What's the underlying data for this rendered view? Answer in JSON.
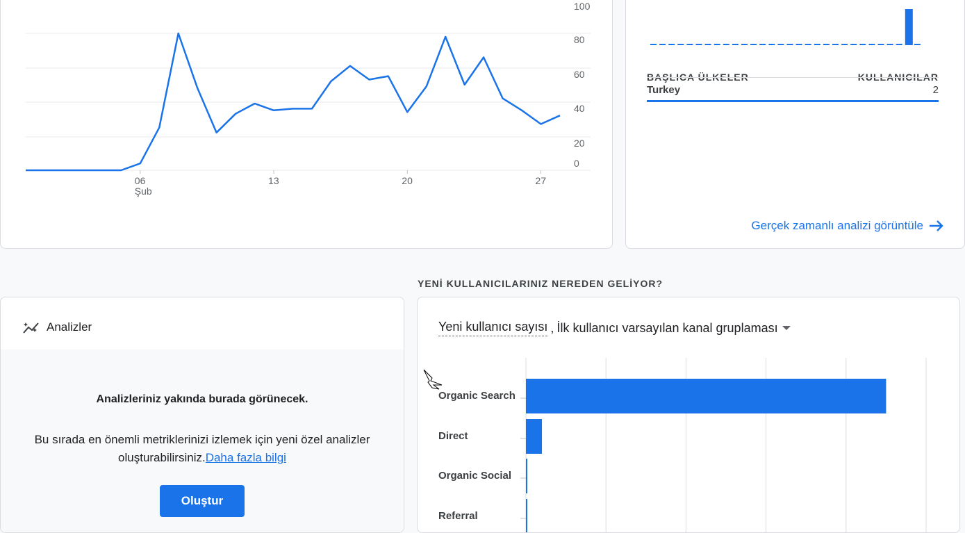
{
  "line_chart": {
    "type": "line",
    "y_ticks": [
      "100",
      "80",
      "60",
      "40",
      "20",
      "0"
    ],
    "x_ticks": [
      {
        "day": "06",
        "month": "Şub"
      },
      {
        "day": "13",
        "month": ""
      },
      {
        "day": "20",
        "month": ""
      },
      {
        "day": "27",
        "month": ""
      }
    ],
    "ylim": [
      0,
      100
    ],
    "series": [
      {
        "values": [
          0,
          0,
          0,
          0,
          0,
          0,
          4,
          25,
          80,
          48,
          22,
          33,
          39,
          35,
          36,
          36,
          52,
          61,
          53,
          55,
          34,
          49,
          78,
          50,
          66,
          42,
          35,
          27,
          32
        ]
      }
    ],
    "color": "#1a73e8"
  },
  "realtime": {
    "col_country": "BAŞLICA ÜLKELER",
    "col_users": "KULLANICILAR",
    "rows": [
      {
        "country": "Turkey",
        "users": "2"
      }
    ],
    "link": "Gerçek zamanlı analizi görüntüle"
  },
  "section_title": "YENİ KULLANICILARINIZ NEREDEN GELİYOR?",
  "insights": {
    "title": "Analizler",
    "heading": "Analizleriniz yakında burada görünecek.",
    "desc_line1": "Bu sırada en önemli metriklerinizi izlemek için yeni özel analizler",
    "desc_line2": "oluşturabilirsiniz.",
    "learn_more": "Daha fazla bilgi",
    "create_button": "Oluştur"
  },
  "acquisition": {
    "metric": "Yeni kullanıcı sayısı",
    "separator": ",",
    "dimension": "İlk kullanıcı varsayılan kanal gruplaması"
  },
  "chart_data": [
    {
      "type": "line",
      "x_ticks": [
        "06 Şub",
        "13",
        "20",
        "27"
      ],
      "ylim": [
        0,
        100
      ],
      "series": [
        {
          "values": [
            0,
            0,
            0,
            0,
            0,
            0,
            4,
            25,
            80,
            48,
            22,
            33,
            39,
            35,
            36,
            36,
            52,
            61,
            53,
            55,
            34,
            49,
            78,
            50,
            66,
            42,
            35,
            27,
            32
          ]
        }
      ]
    },
    {
      "type": "bar",
      "orientation": "horizontal",
      "categories": [
        "Organic Search",
        "Direct",
        "Organic Social",
        "Referral"
      ],
      "values": [
        45,
        2,
        0.15,
        0.15
      ],
      "xlim": [
        0,
        50
      ]
    }
  ]
}
